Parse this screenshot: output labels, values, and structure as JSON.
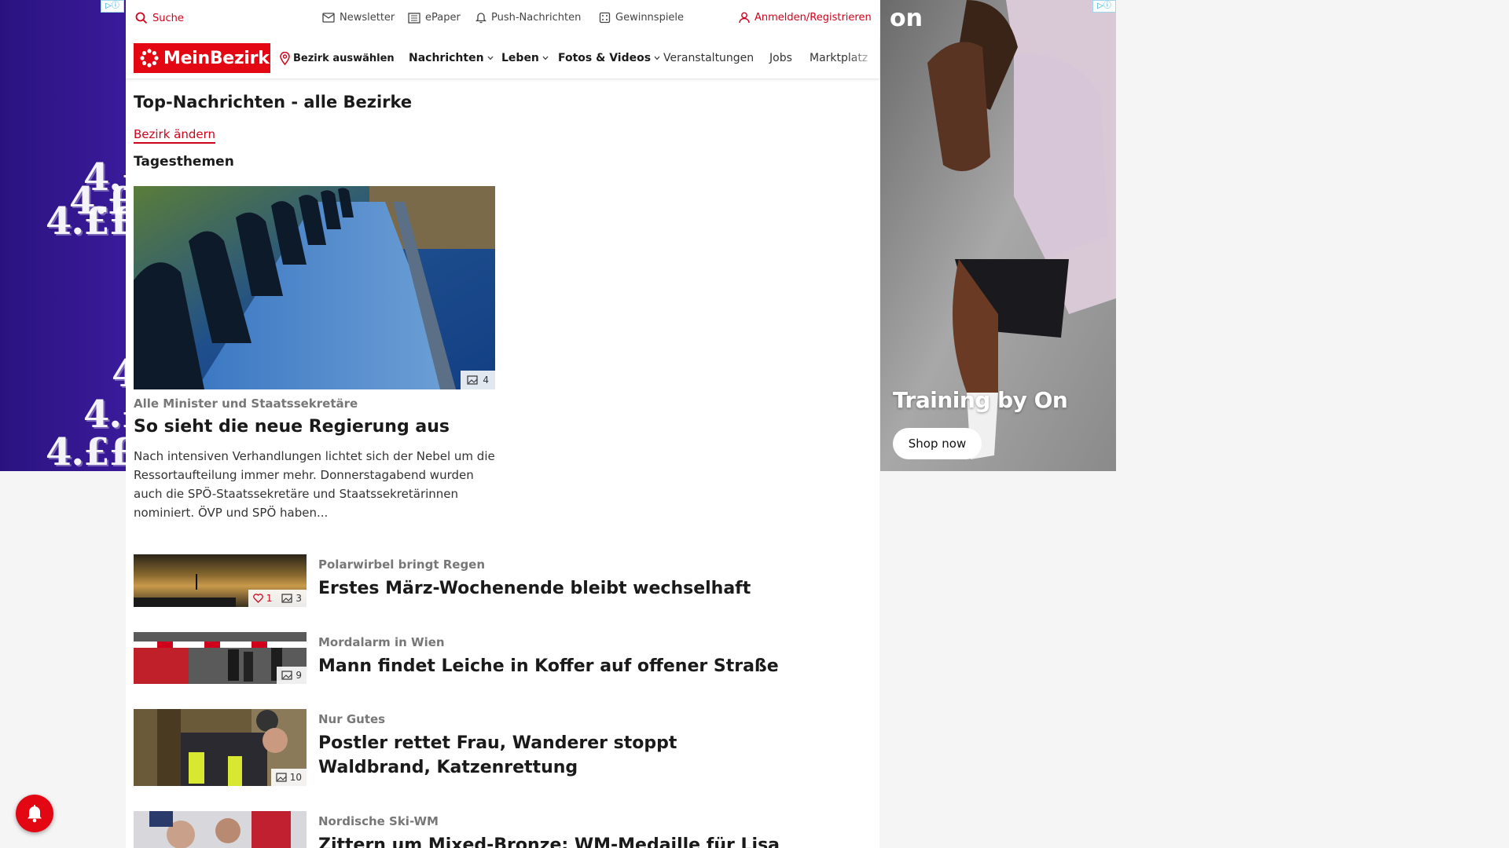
{
  "ads": {
    "left_skin": {
      "texts": [
        "4.£",
        "4.£",
        "4.££",
        "4",
        "4.£",
        "4.££"
      ]
    },
    "right": {
      "brand_logo": "on",
      "headline": "Training by On",
      "cta": "Shop now"
    }
  },
  "topbar": {
    "search": "Suche",
    "newsletter": "Newsletter",
    "epaper": "ePaper",
    "push": "Push-Nachrichten",
    "contests": "Gewinnspiele",
    "login": "Anmelden/Registrieren"
  },
  "nav": {
    "logo": "MeinBezirk",
    "district": "Bezirk auswählen",
    "items": [
      "Nachrichten",
      "Leben",
      "Fotos & Videos",
      "Veranstaltungen",
      "Jobs",
      "Marktplatz"
    ]
  },
  "page": {
    "title": "Top-Nachrichten - alle Bezirke",
    "change_district": "Bezirk ändern",
    "section": "Tagesthemen"
  },
  "hero": {
    "image_count": "4",
    "kicker": "Alle Minister und Staatssekretäre",
    "title": "So sieht die neue Regierung aus",
    "teaser": "Nach intensiven Verhandlungen lichtet sich der Nebel um die Ressortaufteilung immer mehr. Donnerstagabend wurden auch die SPÖ-Staatssekretäre und Staatssekretärinnen nominiert. ÖVP und SPÖ haben..."
  },
  "articles": [
    {
      "kicker": "Polarwirbel bringt Regen",
      "title": "Erstes März-Wochenende bleibt wechselhaft",
      "likes": "1",
      "images": "3"
    },
    {
      "kicker": "Mordalarm in Wien",
      "title": "Mann findet Leiche in Koffer auf offener Straße",
      "images": "9"
    },
    {
      "kicker": "Nur Gutes",
      "title": "Postler rettet Frau, Wanderer stoppt Waldbrand, Katzenrettung",
      "images": "10"
    },
    {
      "kicker": "Nordische Ski-WM",
      "title": "Zittern um Mixed-Bronze: WM-Medaille für Lisa Hirner"
    }
  ],
  "colors": {
    "brand": "#e30613",
    "accent_red": "#d0021b",
    "skin_purple": "#2a1380"
  },
  "icons": [
    "search-icon",
    "mail-icon",
    "newspaper-icon",
    "bell-icon",
    "gift-icon",
    "user-icon",
    "map-pin-icon",
    "chevron-down-icon",
    "image-icon",
    "heart-icon",
    "ad-choices-icon"
  ]
}
